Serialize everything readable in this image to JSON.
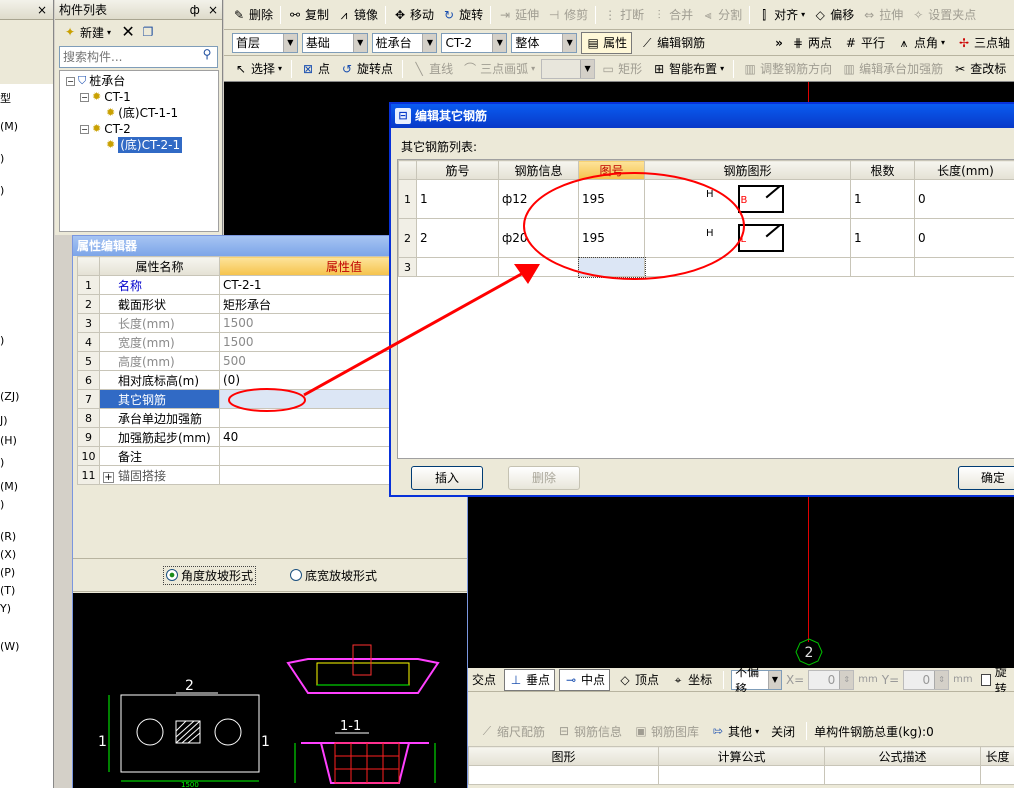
{
  "left_strip": {
    "codes": [
      "型",
      "(M)",
      ")",
      ")",
      ")",
      "(ZJ)",
      "J)",
      "(H)",
      ")",
      "(M)",
      ")",
      "(R)",
      "(X)",
      "(P)",
      "(T)",
      "Y)",
      "(W)"
    ]
  },
  "component_list": {
    "title": "构件列表",
    "pin": "ф",
    "close": "×",
    "new_label": "新建",
    "search_placeholder": "搜索构件...",
    "tree": [
      {
        "label": "桩承台",
        "level": 0
      },
      {
        "label": "CT-1",
        "level": 1
      },
      {
        "label": "(底)CT-1-1",
        "level": 2
      },
      {
        "label": "CT-2",
        "level": 1
      },
      {
        "label": "(底)CT-2-1",
        "level": 2,
        "selected": true
      }
    ]
  },
  "toolbar1": {
    "delete": "删除",
    "copy": "复制",
    "mirror": "镜像",
    "move": "移动",
    "rotate": "旋转",
    "extend": "延伸",
    "trim": "修剪",
    "break": "打断",
    "merge": "合并",
    "split": "分割",
    "align": "对齐",
    "offset": "偏移",
    "stretch": "拉伸",
    "setpoint": "设置夹点"
  },
  "toolbar2": {
    "floor": "首层",
    "category": "基础",
    "type": "桩承台",
    "component": "CT-2",
    "part": "整体",
    "property": "属性",
    "edit_rebar": "编辑钢筋",
    "two_points": "两点",
    "parallel": "平行",
    "point_angle": "点角",
    "three_points": "三点轴"
  },
  "toolbar3": {
    "select": "选择",
    "point": "点",
    "rotate_point": "旋转点",
    "line": "直线",
    "arc": "三点画弧",
    "rect": "矩形",
    "smart": "智能布置",
    "adjust_dir": "调整钢筋方向",
    "edit_strength": "编辑承台加强筋",
    "check": "查改标"
  },
  "property_editor": {
    "title": "属性编辑器",
    "col_name": "属性名称",
    "col_value": "属性值",
    "rows": [
      {
        "n": "1",
        "name": "名称",
        "value": "CT-2-1",
        "style": "link"
      },
      {
        "n": "2",
        "name": "截面形状",
        "value": "矩形承台",
        "style": "normal"
      },
      {
        "n": "3",
        "name": "长度(mm)",
        "value": "1500",
        "style": "gray"
      },
      {
        "n": "4",
        "name": "宽度(mm)",
        "value": "1500",
        "style": "gray"
      },
      {
        "n": "5",
        "name": "高度(mm)",
        "value": "500",
        "style": "gray"
      },
      {
        "n": "6",
        "name": "相对底标高(m)",
        "value": "(0)",
        "style": "normal"
      },
      {
        "n": "7",
        "name": "其它钢筋",
        "value": "",
        "style": "selected"
      },
      {
        "n": "8",
        "name": "承台单边加强筋",
        "value": "",
        "style": "normal"
      },
      {
        "n": "9",
        "name": "加强筋起步(mm)",
        "value": "40",
        "style": "normal"
      },
      {
        "n": "10",
        "name": "备注",
        "value": "",
        "style": "normal"
      },
      {
        "n": "11",
        "name": "锚固搭接",
        "value": "",
        "style": "expand"
      }
    ],
    "radio_angle": "角度放坡形式",
    "radio_width": "底宽放坡形式"
  },
  "dialog": {
    "title": "编辑其它钢筋",
    "list_label": "其它钢筋列表:",
    "headers": [
      "",
      "筋号",
      "钢筋信息",
      "图号",
      "钢筋图形",
      "根数",
      "长度(mm)"
    ],
    "rows": [
      {
        "n": "1",
        "bar": "1",
        "info": "ф12",
        "shape_no": "195",
        "shape_mark": "H",
        "shape_letter": "B",
        "count": "1",
        "length": "0"
      },
      {
        "n": "2",
        "bar": "2",
        "info": "ф20",
        "shape_no": "195",
        "shape_mark": "H",
        "shape_letter": "L",
        "count": "1",
        "length": "0"
      },
      {
        "n": "3",
        "bar": "",
        "info": "",
        "shape_no": "",
        "shape_mark": "",
        "shape_letter": "",
        "count": "",
        "length": ""
      }
    ],
    "insert": "插入",
    "delete": "删除",
    "ok": "确定"
  },
  "preview": {
    "label_2": "2",
    "label_1": "1",
    "label_1_right": "1",
    "dim_1500": "1500",
    "section_title": "1-1",
    "axis_marker": "2"
  },
  "snap_toolbar": {
    "intersect": "交点",
    "perpendicular": "垂点",
    "midpoint": "中点",
    "vertex": "顶点",
    "coord": "坐标",
    "offset_mode": "不偏移",
    "x_label": "X=",
    "x_val": "0",
    "y_label": "Y=",
    "y_val": "0",
    "unit": "mm",
    "rotate": "旋转"
  },
  "rebar_toolbar": {
    "scale": "缩尺配筋",
    "info": "钢筋信息",
    "library": "钢筋图库",
    "other": "其他",
    "close": "关闭",
    "total_weight": "单构件钢筋总重(kg):0"
  },
  "rebar_table_headers": [
    "图形",
    "计算公式",
    "公式描述",
    "长度"
  ],
  "colors": {
    "cad_bg": "#000000",
    "red_annotation": "#ff0000",
    "dialog_title": "#0a246a",
    "selected_row": "#316ac5"
  }
}
